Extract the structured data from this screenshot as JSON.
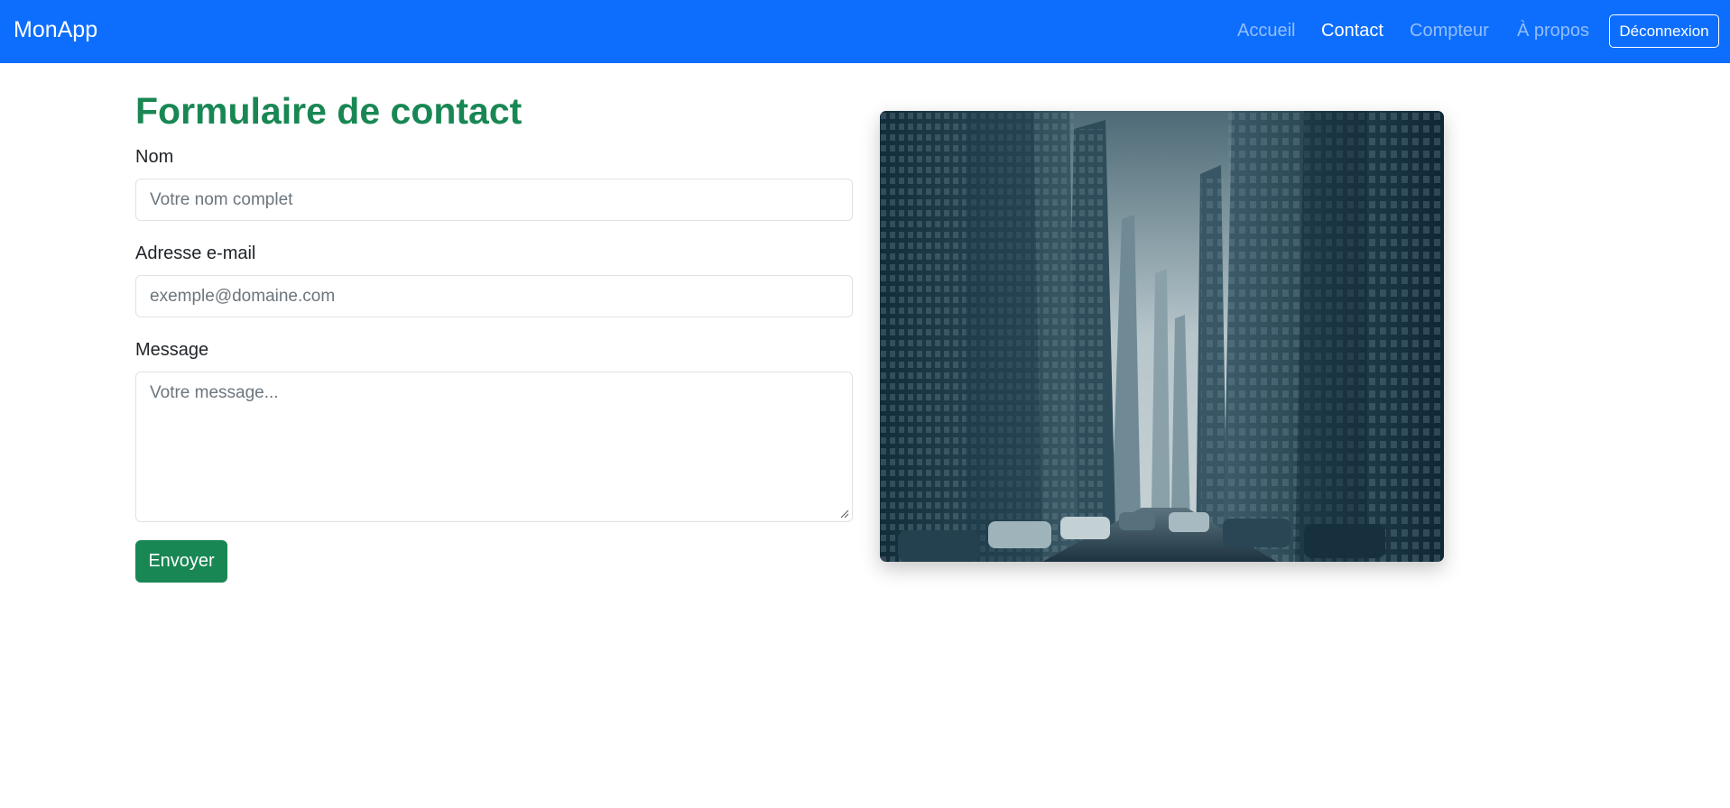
{
  "navbar": {
    "brand": "MonApp",
    "links": [
      {
        "label": "Accueil",
        "active": false
      },
      {
        "label": "Contact",
        "active": true
      },
      {
        "label": "Compteur",
        "active": false
      },
      {
        "label": "À propos",
        "active": false
      }
    ],
    "logout_label": "Déconnexion",
    "background_color": "#0d6efd"
  },
  "main": {
    "title": "Formulaire de contact",
    "title_color": "#198754",
    "form": {
      "name": {
        "label": "Nom",
        "placeholder": "Votre nom complet",
        "value": ""
      },
      "email": {
        "label": "Adresse e-mail",
        "placeholder": "exemple@domaine.com",
        "value": ""
      },
      "message": {
        "label": "Message",
        "placeholder": "Votre message...",
        "value": ""
      },
      "submit_label": "Envoyer",
      "submit_color": "#198754"
    },
    "image": {
      "subject": "city-street-skyscrapers"
    }
  }
}
